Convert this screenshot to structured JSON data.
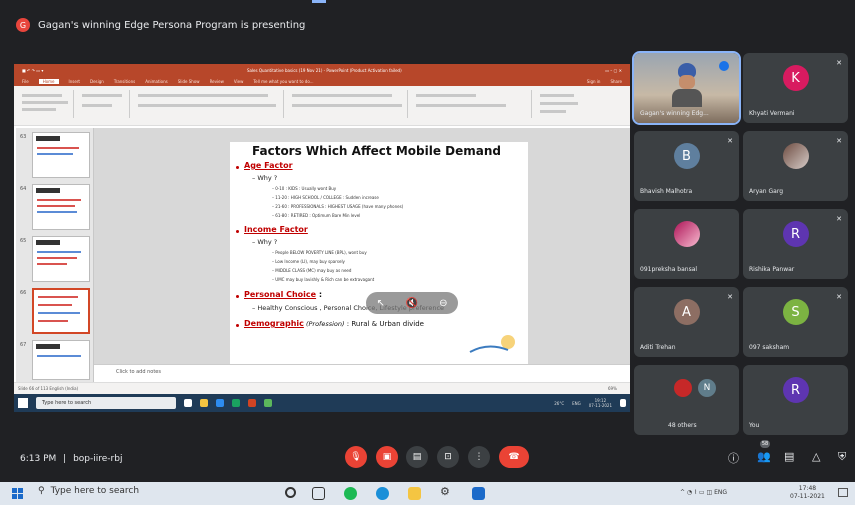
{
  "presenter_banner": {
    "initial": "G",
    "text": "Gagan's winning Edge Persona Program is presenting"
  },
  "powerpoint": {
    "window_title": "Sales Quantitative basics (19 Nov 21) - PowerPoint (Product Activation failed)",
    "tabs": [
      "File",
      "Home",
      "Insert",
      "Design",
      "Transitions",
      "Animations",
      "Slide Show",
      "Review",
      "View",
      "Tell me what you want to do..."
    ],
    "signin": "Sign in",
    "share": "Share",
    "slide_numbers": [
      "63",
      "64",
      "65",
      "66",
      "67"
    ],
    "notes_placeholder": "Click to add notes",
    "status_left": "Slide 66 of 113  English (India)",
    "status_zoom": "69%"
  },
  "slide": {
    "title": "Factors Which Affect Mobile Demand",
    "sections": {
      "age_factor": "Age Factor",
      "why1": "– Why ?",
      "age_items": [
        "– 0-10 : KIDS : Usually wont Buy",
        "– 11-20 : HIGH SCHOOL / COLLEGE : Sudden increase",
        "– 21-60 : PROFESSIONALS : HIGHEST USAGE (have many phones)",
        "– 61-80 : RETIRED : Optimum Bare Min level"
      ],
      "income_factor": "Income Factor",
      "why2": "– Why ?",
      "income_items": [
        "– People BELOW POVERTY LINE (BPL), wont buy",
        "– Low Income (LI), may buy sparsely",
        "– MIDDLE CLASS (MC) may buy as need",
        "– UMC may buy lavishly & Rich can be extravagant"
      ],
      "personal_choice": "Personal Choice",
      "personal_colon": " :",
      "personal_line": "– Healthy Conscious , Personal Choice, Lifestyle preference",
      "demographic": "Demographic",
      "demographic_italic": " (Profession)",
      "demographic_rest": " : Rural & Urban divide"
    }
  },
  "inner_taskbar": {
    "search": "Type here to search",
    "temp": "26°C",
    "lang": "ENG",
    "time": "19:12",
    "date": "07-11-2021"
  },
  "participants": [
    {
      "name": "Gagan's winning Edg...",
      "type": "video"
    },
    {
      "name": "Khyati Vermani",
      "initial": "K",
      "color": "#d81b60"
    },
    {
      "name": "Bhavish Malhotra",
      "initial": "B",
      "color": "#5f7f9e"
    },
    {
      "name": "Aryan Garg",
      "type": "photo"
    },
    {
      "name": "091preksha bansal",
      "type": "photo"
    },
    {
      "name": "Rishika Panwar",
      "initial": "R",
      "color": "#5e35b1"
    },
    {
      "name": "Aditi Trehan",
      "initial": "A",
      "color": "#8d6e63"
    },
    {
      "name": "097 saksham",
      "initial": "S",
      "color": "#7cb342"
    },
    {
      "name": "48 others",
      "initial": "N",
      "color": "#607d8b"
    },
    {
      "name": "You",
      "initial": "R",
      "color": "#5e35b1"
    }
  ],
  "meeting": {
    "time": "6:13 PM",
    "separator": "|",
    "code": "bop-iire-rbj",
    "people_count": "58"
  },
  "taskbar": {
    "search": "Type here to search",
    "lang": "ENG",
    "time": "17:48",
    "date": "07-11-2021"
  },
  "colors": {
    "accent": "#8ab4f8",
    "end_call": "#ea4335",
    "ppt": "#b7472a"
  }
}
